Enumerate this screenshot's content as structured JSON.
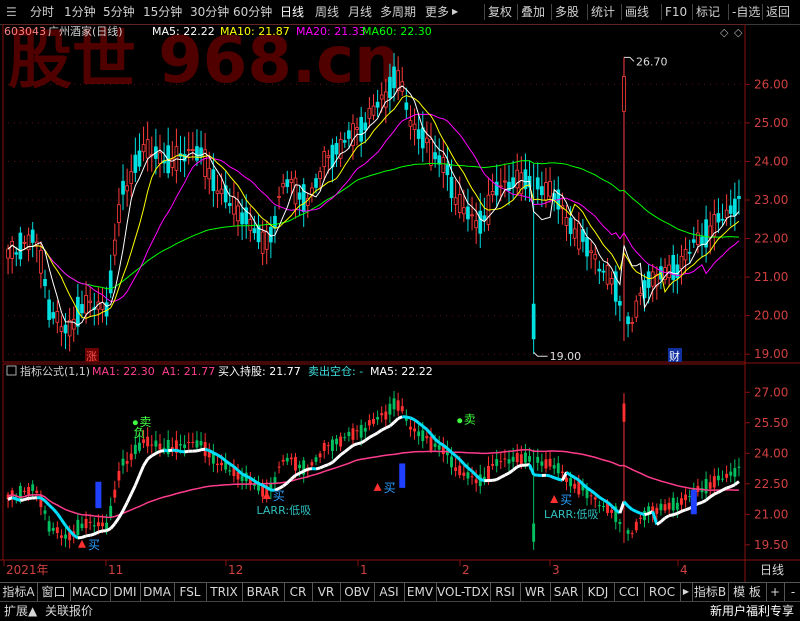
{
  "toolbar": {
    "periods": [
      "分时",
      "1分钟",
      "5分钟",
      "15分钟",
      "30分钟",
      "60分钟",
      "日线",
      "周线",
      "月线",
      "多周期",
      "更多"
    ],
    "more_arrow": "▶",
    "actions": [
      "复权",
      "叠加",
      "多股",
      "统计",
      "画线",
      "F10",
      "标记",
      "-自选",
      "返回"
    ]
  },
  "watermark": "股世 968.cn",
  "upper": {
    "stock_code": "603043",
    "stock_name": "广州酒家(日线)",
    "ma5": "MA5: 22.22",
    "ma10": "MA10: 21.87",
    "ma20": "MA20: 21.33",
    "ma60": "MA60: 22.30",
    "high_label": "26.70",
    "low_label": "19.00",
    "marker_zhang": "涨",
    "marker_cai": "财",
    "ticks": [
      "26.00",
      "25.00",
      "24.00",
      "23.00",
      "22.00",
      "21.00",
      "20.00",
      "19.00"
    ],
    "tick_values": [
      26,
      25,
      24,
      23,
      22,
      21,
      20,
      19
    ],
    "range": [
      18.85,
      27.15
    ],
    "diamond_icons": [
      "◇",
      "◇"
    ],
    "colors": {
      "up": "#ff3c3c",
      "down": "#00e0e0",
      "ma5": "#ffffff",
      "ma10": "#ffff00",
      "ma20": "#ff00ff",
      "ma60": "#00ff00"
    }
  },
  "lower": {
    "formula": "指标公式(1,1)",
    "ma1": "MA1: 22.30",
    "a1": "A1: 21.77",
    "buy_hold": "买入持股: 21.77",
    "sell_empty": "卖出空仓: -",
    "ma5": "MA5: 22.22",
    "sell_labels": [
      "卖",
      "卖"
    ],
    "fu_label": "负",
    "buy_labels": [
      "买",
      "买",
      "买",
      "买"
    ],
    "larr_labels": [
      "LARR:低吸",
      "LARR:低吸"
    ],
    "ticks": [
      "27.00",
      "25.50",
      "24.00",
      "22.50",
      "21.00",
      "19.50"
    ],
    "tick_values": [
      27,
      25.5,
      24,
      22.5,
      21,
      19.5
    ],
    "range": [
      18.9,
      27.8
    ],
    "colors": {
      "up": "#ff3030",
      "down": "#00c060",
      "trend_up": "#ffffff",
      "trend_down": "#00e0ff",
      "ma": "#ff3c8c"
    }
  },
  "xaxis": {
    "labels": [
      "2021年",
      "11",
      "12",
      "1",
      "2",
      "3",
      "4"
    ],
    "period_label": "日线"
  },
  "bottom_tabs": [
    "指标A",
    "窗口",
    "MACD",
    "DMI",
    "DMA",
    "FSL",
    "TRIX",
    "BRAR",
    "CR",
    "VR",
    "OBV",
    "ASI",
    "EMV",
    "VOL-TDX",
    "RSI",
    "WR",
    "SAR",
    "KDJ",
    "CCI",
    "ROC"
  ],
  "bottom_right": {
    "arrow": "▶",
    "indicator_b": "指标B",
    "board": "模 板",
    "plus": "+",
    "minus": "-"
  },
  "status": {
    "expand": "扩展▲",
    "related": "关联报价",
    "promo": "新用户福利专享"
  }
}
